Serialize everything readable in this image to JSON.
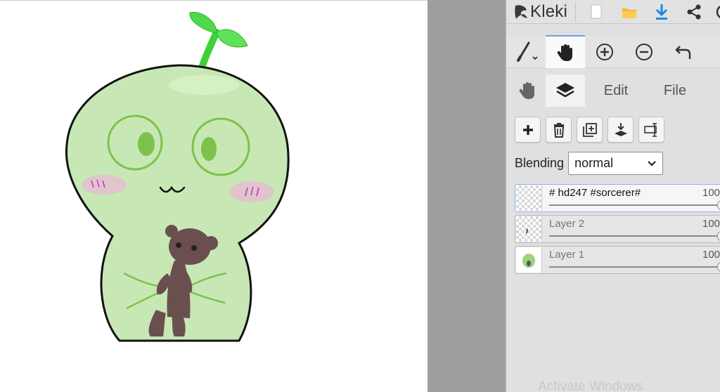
{
  "app": {
    "name": "Kleki"
  },
  "tools": {
    "brush": "brush-tool",
    "hand": "hand-tool",
    "zoom_in": "zoom-in",
    "zoom_out": "zoom-out",
    "undo": "undo"
  },
  "tabs": [
    {
      "label": "Edit"
    },
    {
      "label": "File"
    }
  ],
  "layers_panel": {
    "blending_label": "Blending",
    "blending_value": "normal",
    "layers": [
      {
        "name": "# hd247 #sorcerer#",
        "opacity": "100"
      },
      {
        "name": "Layer 2",
        "opacity": "100"
      },
      {
        "name": "Layer 1",
        "opacity": "100"
      }
    ]
  },
  "watermark": "Activate Windows",
  "colors": {
    "accent": "#6aa0e0",
    "download": "#1e88e5",
    "folder": "#f5b82e",
    "creature": "#c5e6b0",
    "sprout": "#3fd13a"
  }
}
